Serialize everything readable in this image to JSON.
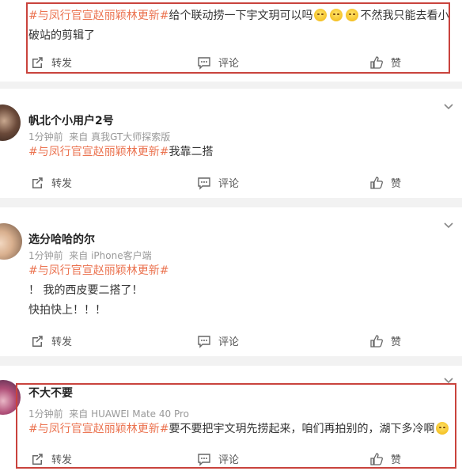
{
  "colors": {
    "tag": "#eb7350",
    "highlight_box": "#c9433d"
  },
  "actions": {
    "repost": "转发",
    "comment": "评论",
    "like": "赞"
  },
  "posts": [
    {
      "tag": "#与凤行官宣赵丽颖林更新#",
      "text_lines": [
        "给个联动捞一下宇文玥可以吗",
        "不然我只能去看小",
        "破站的剪辑了"
      ],
      "emoji_count": 3,
      "highlighted": true
    },
    {
      "name": "帆北个小用户2号",
      "time": "1分钟前",
      "source": "来自 真我GT大师探索版",
      "tag": "#与凤行官宣赵丽颖林更新#",
      "text": "我靠二搭"
    },
    {
      "name": "选分哈哈的尔",
      "time": "1分钟前",
      "source": "来自 iPhone客户端",
      "tag": "#与凤行官宣赵丽颖林更新#",
      "lines": [
        "！ 我的西皮要二搭了！",
        "快拍快上！！！"
      ]
    },
    {
      "name": "不大不要",
      "time": "1分钟前",
      "source": "来自 HUAWEI Mate 40 Pro",
      "tag": "#与凤行官宣赵丽颖林更新#",
      "text": "要不要把宇文玥先捞起来，咱们再拍别的，湖下多冷啊",
      "emoji_count": 1,
      "highlighted": true
    }
  ]
}
